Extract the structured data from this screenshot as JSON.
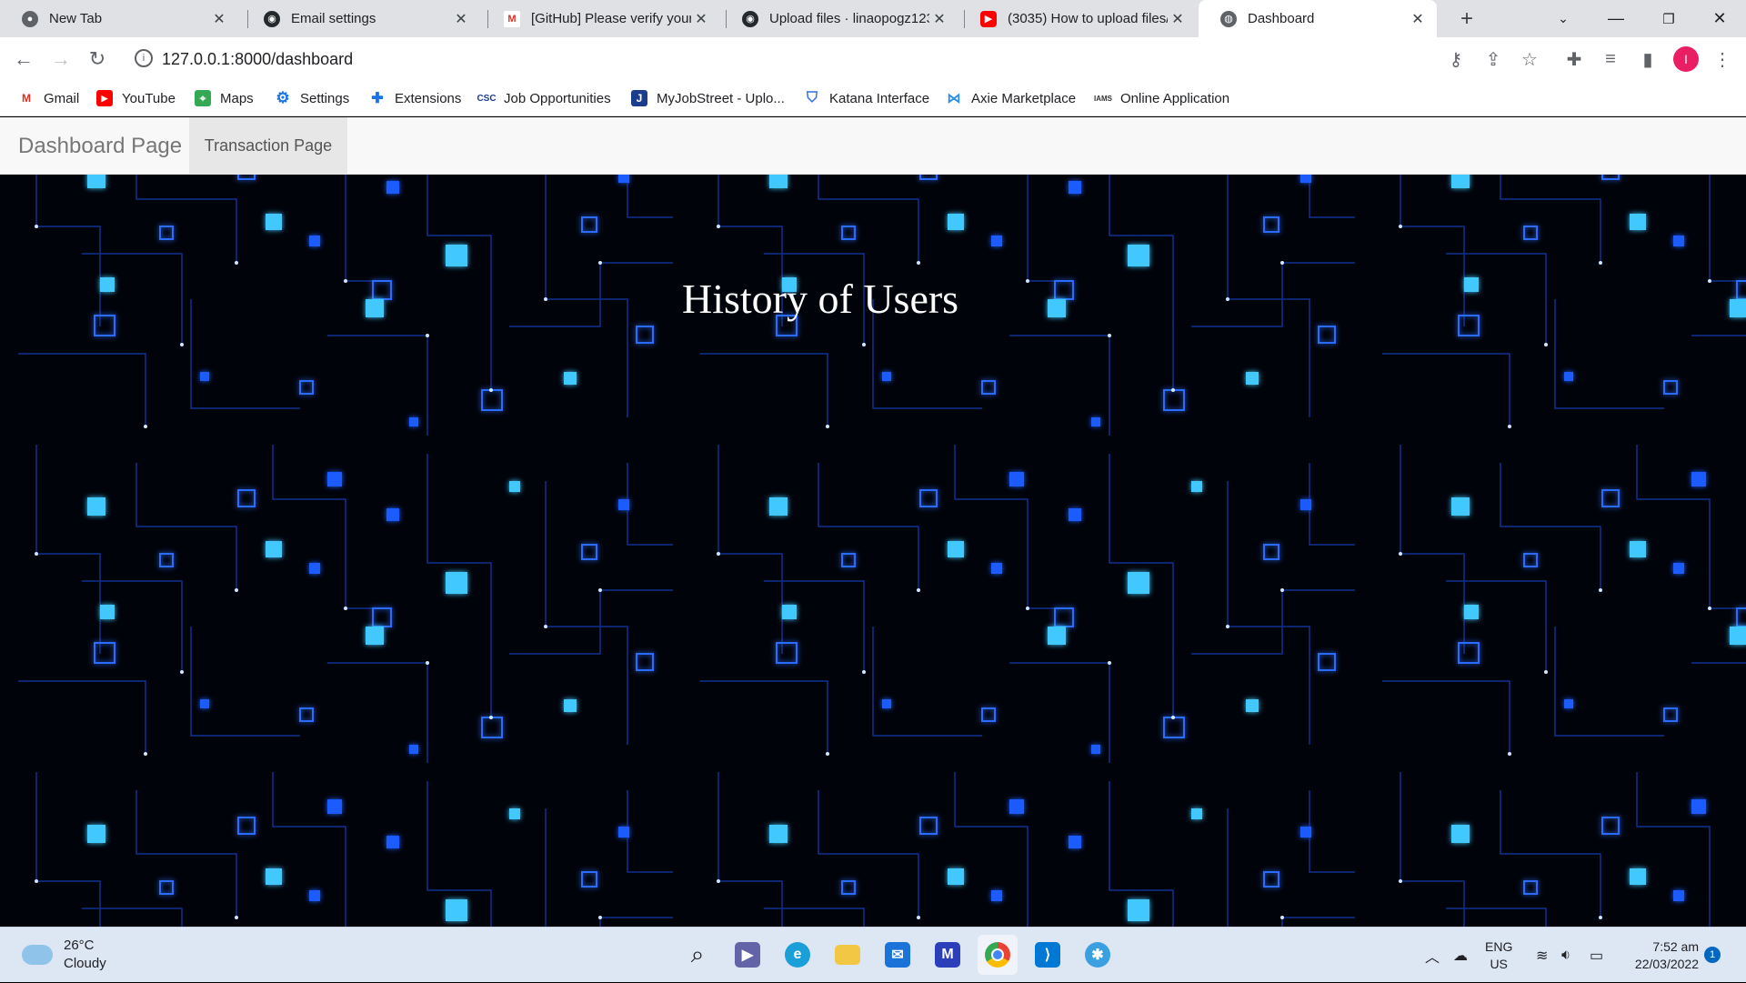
{
  "browser": {
    "tabs": [
      {
        "title": "New Tab",
        "icon": "chrome-icon"
      },
      {
        "title": "Email settings",
        "icon": "github-icon"
      },
      {
        "title": "[GitHub] Please verify your",
        "icon": "gmail-icon"
      },
      {
        "title": "Upload files · linaopogz123",
        "icon": "github-icon"
      },
      {
        "title": "(3035) How to upload files/",
        "icon": "youtube-icon"
      },
      {
        "title": "Dashboard",
        "icon": "globe-icon",
        "active": true
      }
    ],
    "url": "127.0.0.1:8000/dashboard",
    "profile_initial": "I",
    "bookmarks": [
      {
        "label": "Gmail",
        "icon": "gmail-icon"
      },
      {
        "label": "YouTube",
        "icon": "youtube-icon"
      },
      {
        "label": "Maps",
        "icon": "maps-icon"
      },
      {
        "label": "Settings",
        "icon": "gear-icon"
      },
      {
        "label": "Extensions",
        "icon": "puzzle-icon"
      },
      {
        "label": "Job Opportunities",
        "icon": "csc-icon"
      },
      {
        "label": "MyJobStreet - Uplo...",
        "icon": "jobstreet-icon"
      },
      {
        "label": "Katana Interface",
        "icon": "shield-icon"
      },
      {
        "label": "Axie Marketplace",
        "icon": "axie-icon"
      },
      {
        "label": "Online Application",
        "icon": "iams-icon"
      }
    ]
  },
  "page": {
    "nav": {
      "brand": "Dashboard Page",
      "link": "Transaction Page"
    },
    "heading": "History of Users"
  },
  "taskbar": {
    "weather": {
      "temp": "26°C",
      "condition": "Cloudy"
    },
    "lang_top": "ENG",
    "lang_bottom": "US",
    "time": "7:52 am",
    "date": "22/03/2022",
    "notification_count": "1"
  }
}
